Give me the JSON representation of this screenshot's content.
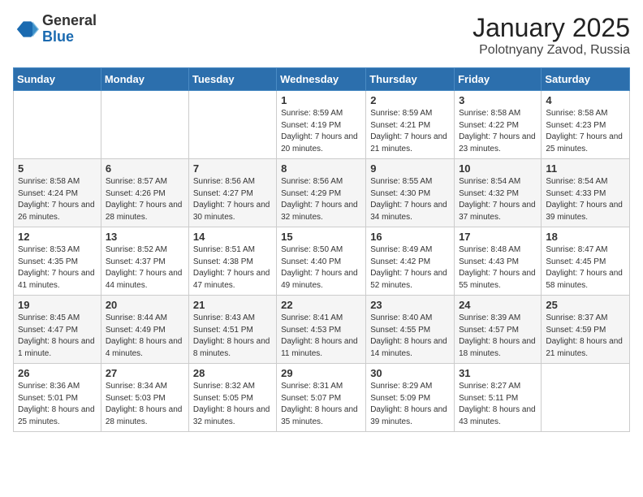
{
  "header": {
    "logo_general": "General",
    "logo_blue": "Blue",
    "month_title": "January 2025",
    "location": "Polotnyany Zavod, Russia"
  },
  "weekdays": [
    "Sunday",
    "Monday",
    "Tuesday",
    "Wednesday",
    "Thursday",
    "Friday",
    "Saturday"
  ],
  "weeks": [
    [
      {
        "day": "",
        "info": ""
      },
      {
        "day": "",
        "info": ""
      },
      {
        "day": "",
        "info": ""
      },
      {
        "day": "1",
        "info": "Sunrise: 8:59 AM\nSunset: 4:19 PM\nDaylight: 7 hours\nand 20 minutes."
      },
      {
        "day": "2",
        "info": "Sunrise: 8:59 AM\nSunset: 4:21 PM\nDaylight: 7 hours\nand 21 minutes."
      },
      {
        "day": "3",
        "info": "Sunrise: 8:58 AM\nSunset: 4:22 PM\nDaylight: 7 hours\nand 23 minutes."
      },
      {
        "day": "4",
        "info": "Sunrise: 8:58 AM\nSunset: 4:23 PM\nDaylight: 7 hours\nand 25 minutes."
      }
    ],
    [
      {
        "day": "5",
        "info": "Sunrise: 8:58 AM\nSunset: 4:24 PM\nDaylight: 7 hours\nand 26 minutes."
      },
      {
        "day": "6",
        "info": "Sunrise: 8:57 AM\nSunset: 4:26 PM\nDaylight: 7 hours\nand 28 minutes."
      },
      {
        "day": "7",
        "info": "Sunrise: 8:56 AM\nSunset: 4:27 PM\nDaylight: 7 hours\nand 30 minutes."
      },
      {
        "day": "8",
        "info": "Sunrise: 8:56 AM\nSunset: 4:29 PM\nDaylight: 7 hours\nand 32 minutes."
      },
      {
        "day": "9",
        "info": "Sunrise: 8:55 AM\nSunset: 4:30 PM\nDaylight: 7 hours\nand 34 minutes."
      },
      {
        "day": "10",
        "info": "Sunrise: 8:54 AM\nSunset: 4:32 PM\nDaylight: 7 hours\nand 37 minutes."
      },
      {
        "day": "11",
        "info": "Sunrise: 8:54 AM\nSunset: 4:33 PM\nDaylight: 7 hours\nand 39 minutes."
      }
    ],
    [
      {
        "day": "12",
        "info": "Sunrise: 8:53 AM\nSunset: 4:35 PM\nDaylight: 7 hours\nand 41 minutes."
      },
      {
        "day": "13",
        "info": "Sunrise: 8:52 AM\nSunset: 4:37 PM\nDaylight: 7 hours\nand 44 minutes."
      },
      {
        "day": "14",
        "info": "Sunrise: 8:51 AM\nSunset: 4:38 PM\nDaylight: 7 hours\nand 47 minutes."
      },
      {
        "day": "15",
        "info": "Sunrise: 8:50 AM\nSunset: 4:40 PM\nDaylight: 7 hours\nand 49 minutes."
      },
      {
        "day": "16",
        "info": "Sunrise: 8:49 AM\nSunset: 4:42 PM\nDaylight: 7 hours\nand 52 minutes."
      },
      {
        "day": "17",
        "info": "Sunrise: 8:48 AM\nSunset: 4:43 PM\nDaylight: 7 hours\nand 55 minutes."
      },
      {
        "day": "18",
        "info": "Sunrise: 8:47 AM\nSunset: 4:45 PM\nDaylight: 7 hours\nand 58 minutes."
      }
    ],
    [
      {
        "day": "19",
        "info": "Sunrise: 8:45 AM\nSunset: 4:47 PM\nDaylight: 8 hours\nand 1 minute."
      },
      {
        "day": "20",
        "info": "Sunrise: 8:44 AM\nSunset: 4:49 PM\nDaylight: 8 hours\nand 4 minutes."
      },
      {
        "day": "21",
        "info": "Sunrise: 8:43 AM\nSunset: 4:51 PM\nDaylight: 8 hours\nand 8 minutes."
      },
      {
        "day": "22",
        "info": "Sunrise: 8:41 AM\nSunset: 4:53 PM\nDaylight: 8 hours\nand 11 minutes."
      },
      {
        "day": "23",
        "info": "Sunrise: 8:40 AM\nSunset: 4:55 PM\nDaylight: 8 hours\nand 14 minutes."
      },
      {
        "day": "24",
        "info": "Sunrise: 8:39 AM\nSunset: 4:57 PM\nDaylight: 8 hours\nand 18 minutes."
      },
      {
        "day": "25",
        "info": "Sunrise: 8:37 AM\nSunset: 4:59 PM\nDaylight: 8 hours\nand 21 minutes."
      }
    ],
    [
      {
        "day": "26",
        "info": "Sunrise: 8:36 AM\nSunset: 5:01 PM\nDaylight: 8 hours\nand 25 minutes."
      },
      {
        "day": "27",
        "info": "Sunrise: 8:34 AM\nSunset: 5:03 PM\nDaylight: 8 hours\nand 28 minutes."
      },
      {
        "day": "28",
        "info": "Sunrise: 8:32 AM\nSunset: 5:05 PM\nDaylight: 8 hours\nand 32 minutes."
      },
      {
        "day": "29",
        "info": "Sunrise: 8:31 AM\nSunset: 5:07 PM\nDaylight: 8 hours\nand 35 minutes."
      },
      {
        "day": "30",
        "info": "Sunrise: 8:29 AM\nSunset: 5:09 PM\nDaylight: 8 hours\nand 39 minutes."
      },
      {
        "day": "31",
        "info": "Sunrise: 8:27 AM\nSunset: 5:11 PM\nDaylight: 8 hours\nand 43 minutes."
      },
      {
        "day": "",
        "info": ""
      }
    ]
  ]
}
